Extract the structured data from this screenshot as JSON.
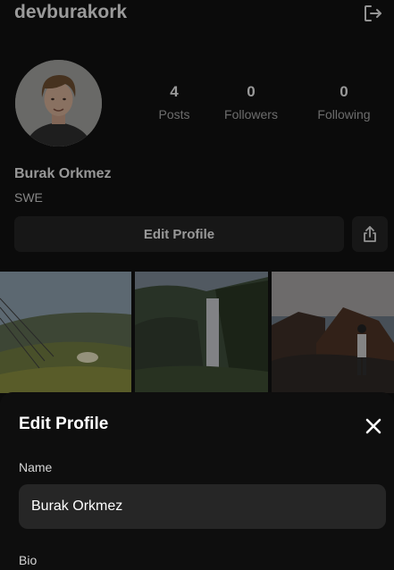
{
  "profile": {
    "username": "devburakork",
    "display_name": "Burak Orkmez",
    "bio": "SWE",
    "stats": [
      {
        "value": "4",
        "label": "Posts"
      },
      {
        "value": "0",
        "label": "Followers"
      },
      {
        "value": "0",
        "label": "Following"
      }
    ],
    "edit_profile_label": "Edit Profile",
    "icons": {
      "logout": "logout-icon",
      "share": "share-icon",
      "avatar": "avatar"
    }
  },
  "posts": [
    {
      "subject": "hillside wildflowers with power lines"
    },
    {
      "subject": "waterfall in green valley"
    },
    {
      "subject": "hiker on coastal rocks"
    }
  ],
  "edit_sheet": {
    "title": "Edit Profile",
    "name_label": "Name",
    "name_value": "Burak Orkmez",
    "bio_label": "Bio",
    "close_icon": "close-icon"
  },
  "colors": {
    "background": "#0b0b0b",
    "button_bg": "#1f1f1f",
    "input_bg": "#262626",
    "sheet_bg": "#0e0e0e"
  }
}
